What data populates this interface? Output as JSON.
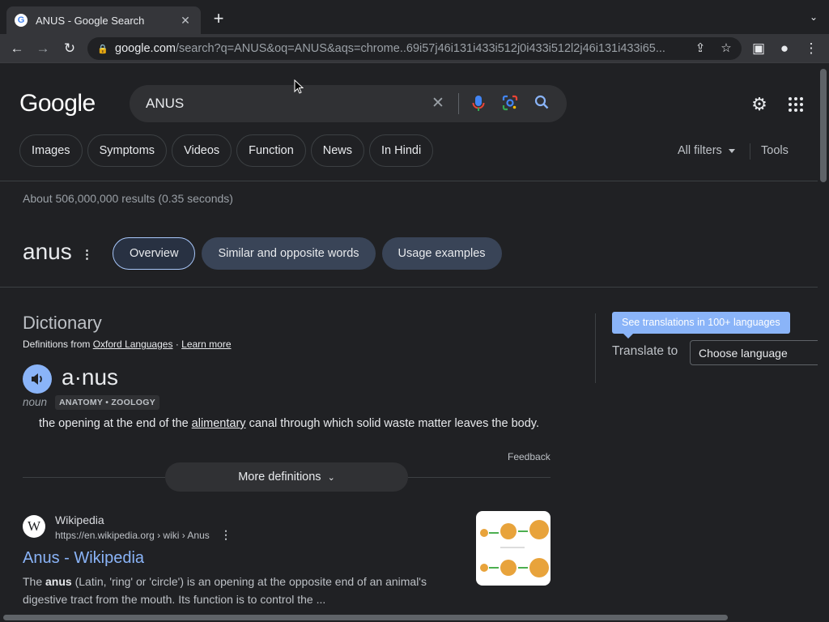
{
  "browser": {
    "tab_title": "ANUS - Google Search",
    "tab_favicon": "G",
    "url_domain": "google.com",
    "url_path": "/search?q=ANUS&oq=ANUS&aqs=chrome..69i57j46i131i433i512j0i433i512l2j46i131i433i65..."
  },
  "search": {
    "logo": "Google",
    "query": "ANUS"
  },
  "chips": [
    "Images",
    "Symptoms",
    "Videos",
    "Function",
    "News",
    "In Hindi"
  ],
  "filters": {
    "all_filters": "All filters",
    "tools": "Tools"
  },
  "stats": "About 506,000,000 results (0.35 seconds)",
  "word_panel": {
    "word": "anus",
    "tabs": [
      "Overview",
      "Similar and opposite words",
      "Usage examples"
    ],
    "active_tab": "Overview"
  },
  "dictionary": {
    "title": "Dictionary",
    "from_prefix": "Definitions from",
    "source": "Oxford Languages",
    "separator": "·",
    "learn_more": "Learn more",
    "headword": "a·nus",
    "pos": "noun",
    "tag": "ANATOMY • ZOOLOGY",
    "definition_before": "the opening at the end of the ",
    "definition_link": "alimentary",
    "definition_after": " canal through which solid waste matter leaves the body.",
    "feedback": "Feedback",
    "more_definitions": "More definitions"
  },
  "translate": {
    "button": "See translations in 100+ languages",
    "label": "Translate to",
    "select_value": "Choose language"
  },
  "result": {
    "site_name": "Wikipedia",
    "url": "https://en.wikipedia.org › wiki › Anus",
    "title": "Anus - Wikipedia",
    "snippet_pre": "The ",
    "snippet_bold": "anus",
    "snippet_post": " (Latin, 'ring' or 'circle') is an opening at the opposite end of an animal's digestive tract from the mouth. Its function is to control the ..."
  },
  "colors": {
    "background": "#202124",
    "link_blue": "#8ab4f8",
    "chip_active": "#283142",
    "chip_bg": "#394457"
  }
}
